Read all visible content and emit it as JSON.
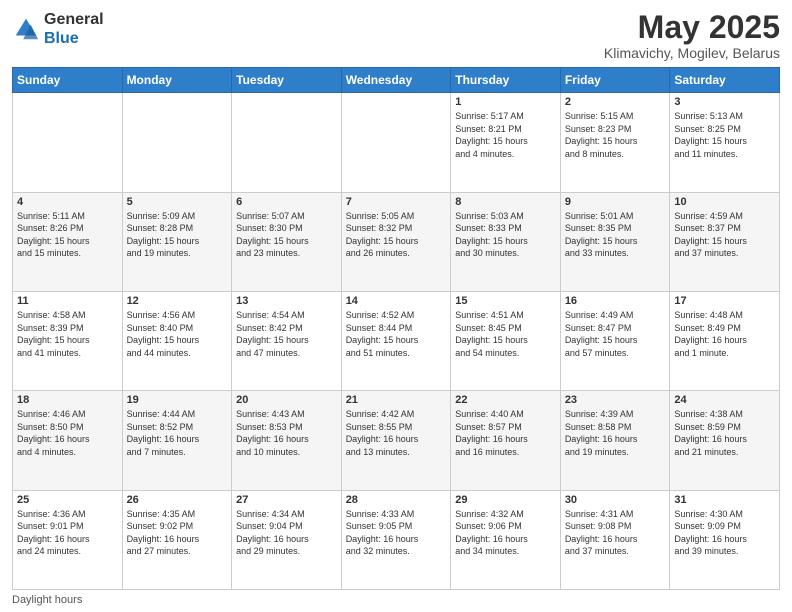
{
  "header": {
    "logo_general": "General",
    "logo_blue": "Blue",
    "month_title": "May 2025",
    "location": "Klimavichy, Mogilev, Belarus"
  },
  "weekdays": [
    "Sunday",
    "Monday",
    "Tuesday",
    "Wednesday",
    "Thursday",
    "Friday",
    "Saturday"
  ],
  "weeks": [
    [
      {
        "day": "",
        "info": ""
      },
      {
        "day": "",
        "info": ""
      },
      {
        "day": "",
        "info": ""
      },
      {
        "day": "",
        "info": ""
      },
      {
        "day": "1",
        "info": "Sunrise: 5:17 AM\nSunset: 8:21 PM\nDaylight: 15 hours\nand 4 minutes."
      },
      {
        "day": "2",
        "info": "Sunrise: 5:15 AM\nSunset: 8:23 PM\nDaylight: 15 hours\nand 8 minutes."
      },
      {
        "day": "3",
        "info": "Sunrise: 5:13 AM\nSunset: 8:25 PM\nDaylight: 15 hours\nand 11 minutes."
      }
    ],
    [
      {
        "day": "4",
        "info": "Sunrise: 5:11 AM\nSunset: 8:26 PM\nDaylight: 15 hours\nand 15 minutes."
      },
      {
        "day": "5",
        "info": "Sunrise: 5:09 AM\nSunset: 8:28 PM\nDaylight: 15 hours\nand 19 minutes."
      },
      {
        "day": "6",
        "info": "Sunrise: 5:07 AM\nSunset: 8:30 PM\nDaylight: 15 hours\nand 23 minutes."
      },
      {
        "day": "7",
        "info": "Sunrise: 5:05 AM\nSunset: 8:32 PM\nDaylight: 15 hours\nand 26 minutes."
      },
      {
        "day": "8",
        "info": "Sunrise: 5:03 AM\nSunset: 8:33 PM\nDaylight: 15 hours\nand 30 minutes."
      },
      {
        "day": "9",
        "info": "Sunrise: 5:01 AM\nSunset: 8:35 PM\nDaylight: 15 hours\nand 33 minutes."
      },
      {
        "day": "10",
        "info": "Sunrise: 4:59 AM\nSunset: 8:37 PM\nDaylight: 15 hours\nand 37 minutes."
      }
    ],
    [
      {
        "day": "11",
        "info": "Sunrise: 4:58 AM\nSunset: 8:39 PM\nDaylight: 15 hours\nand 41 minutes."
      },
      {
        "day": "12",
        "info": "Sunrise: 4:56 AM\nSunset: 8:40 PM\nDaylight: 15 hours\nand 44 minutes."
      },
      {
        "day": "13",
        "info": "Sunrise: 4:54 AM\nSunset: 8:42 PM\nDaylight: 15 hours\nand 47 minutes."
      },
      {
        "day": "14",
        "info": "Sunrise: 4:52 AM\nSunset: 8:44 PM\nDaylight: 15 hours\nand 51 minutes."
      },
      {
        "day": "15",
        "info": "Sunrise: 4:51 AM\nSunset: 8:45 PM\nDaylight: 15 hours\nand 54 minutes."
      },
      {
        "day": "16",
        "info": "Sunrise: 4:49 AM\nSunset: 8:47 PM\nDaylight: 15 hours\nand 57 minutes."
      },
      {
        "day": "17",
        "info": "Sunrise: 4:48 AM\nSunset: 8:49 PM\nDaylight: 16 hours\nand 1 minute."
      }
    ],
    [
      {
        "day": "18",
        "info": "Sunrise: 4:46 AM\nSunset: 8:50 PM\nDaylight: 16 hours\nand 4 minutes."
      },
      {
        "day": "19",
        "info": "Sunrise: 4:44 AM\nSunset: 8:52 PM\nDaylight: 16 hours\nand 7 minutes."
      },
      {
        "day": "20",
        "info": "Sunrise: 4:43 AM\nSunset: 8:53 PM\nDaylight: 16 hours\nand 10 minutes."
      },
      {
        "day": "21",
        "info": "Sunrise: 4:42 AM\nSunset: 8:55 PM\nDaylight: 16 hours\nand 13 minutes."
      },
      {
        "day": "22",
        "info": "Sunrise: 4:40 AM\nSunset: 8:57 PM\nDaylight: 16 hours\nand 16 minutes."
      },
      {
        "day": "23",
        "info": "Sunrise: 4:39 AM\nSunset: 8:58 PM\nDaylight: 16 hours\nand 19 minutes."
      },
      {
        "day": "24",
        "info": "Sunrise: 4:38 AM\nSunset: 8:59 PM\nDaylight: 16 hours\nand 21 minutes."
      }
    ],
    [
      {
        "day": "25",
        "info": "Sunrise: 4:36 AM\nSunset: 9:01 PM\nDaylight: 16 hours\nand 24 minutes."
      },
      {
        "day": "26",
        "info": "Sunrise: 4:35 AM\nSunset: 9:02 PM\nDaylight: 16 hours\nand 27 minutes."
      },
      {
        "day": "27",
        "info": "Sunrise: 4:34 AM\nSunset: 9:04 PM\nDaylight: 16 hours\nand 29 minutes."
      },
      {
        "day": "28",
        "info": "Sunrise: 4:33 AM\nSunset: 9:05 PM\nDaylight: 16 hours\nand 32 minutes."
      },
      {
        "day": "29",
        "info": "Sunrise: 4:32 AM\nSunset: 9:06 PM\nDaylight: 16 hours\nand 34 minutes."
      },
      {
        "day": "30",
        "info": "Sunrise: 4:31 AM\nSunset: 9:08 PM\nDaylight: 16 hours\nand 37 minutes."
      },
      {
        "day": "31",
        "info": "Sunrise: 4:30 AM\nSunset: 9:09 PM\nDaylight: 16 hours\nand 39 minutes."
      }
    ]
  ],
  "footer": {
    "daylight_label": "Daylight hours"
  },
  "colors": {
    "header_bg": "#2e7ec9",
    "header_text": "#ffffff",
    "accent": "#1a6faf"
  }
}
